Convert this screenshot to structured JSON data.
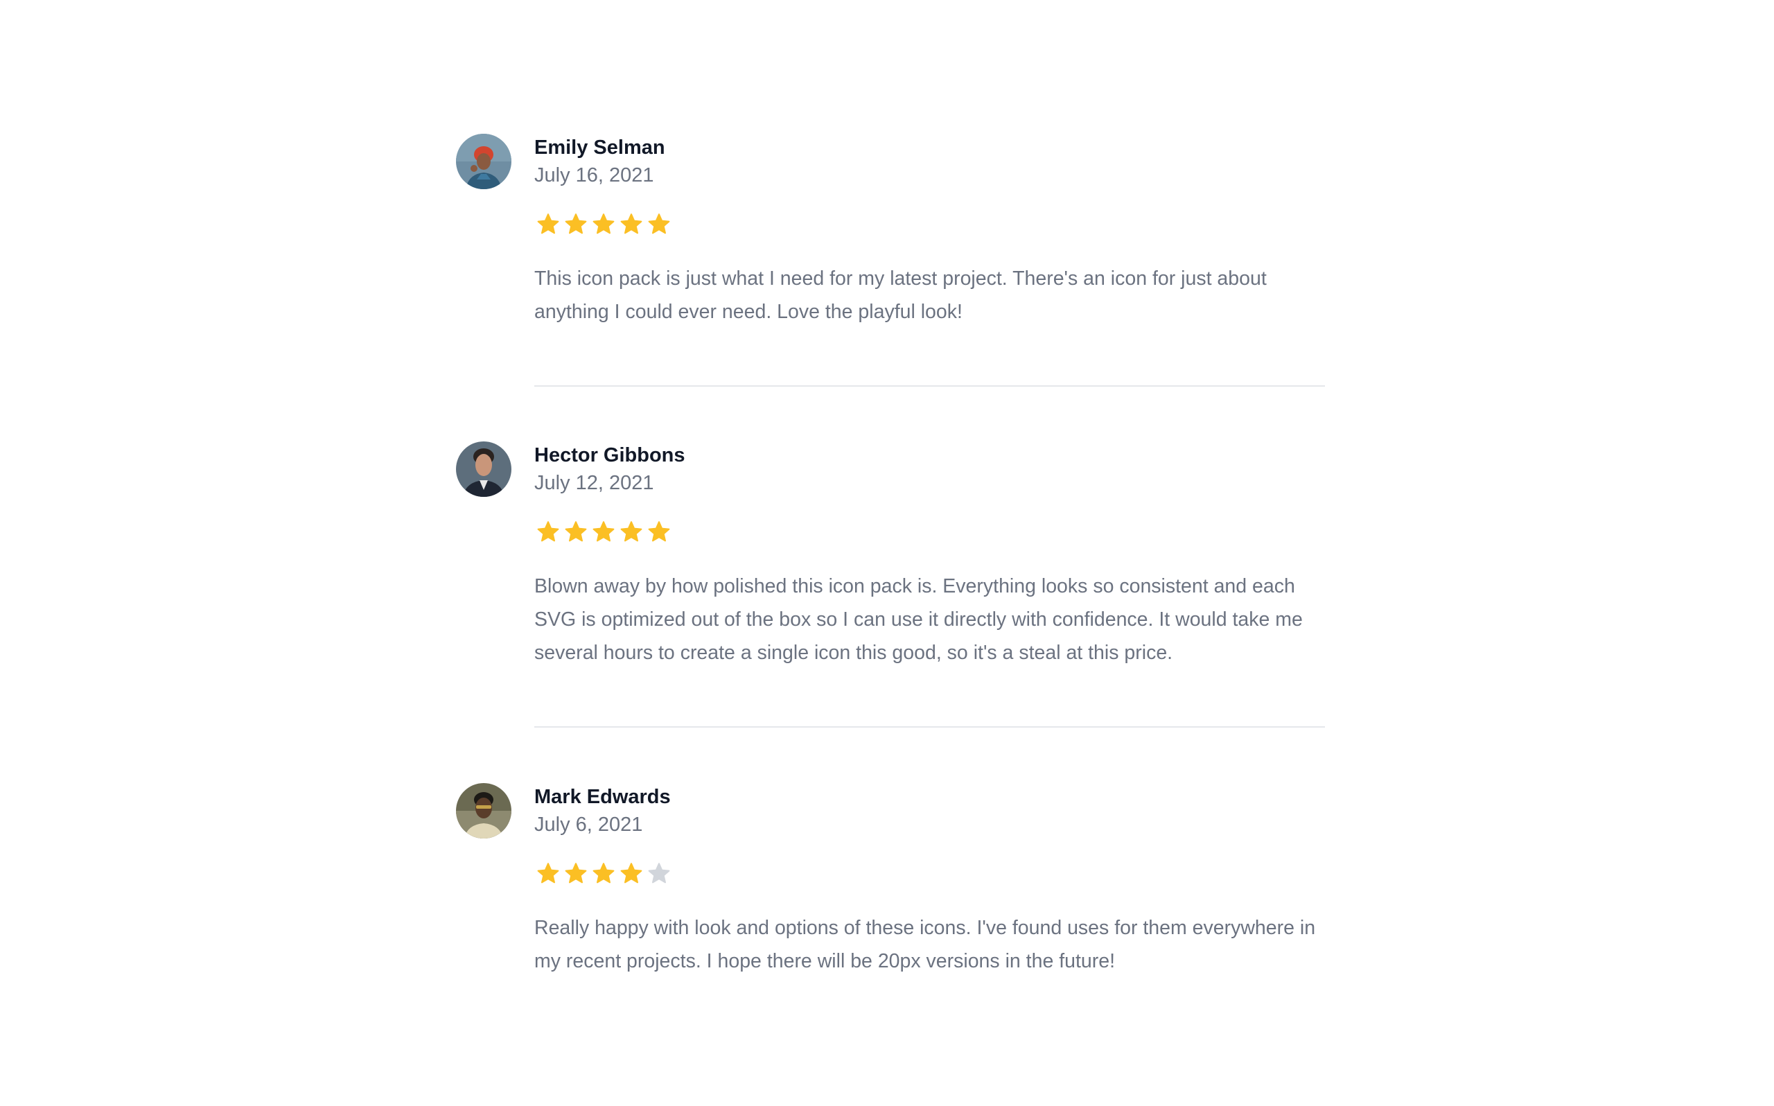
{
  "reviews": [
    {
      "name": "Emily Selman",
      "date": "July 16, 2021",
      "rating": 5,
      "max_rating": 5,
      "text": "This icon pack is just what I need for my latest project. There's an icon for just about anything I could ever need. Love the playful look!"
    },
    {
      "name": "Hector Gibbons",
      "date": "July 12, 2021",
      "rating": 5,
      "max_rating": 5,
      "text": "Blown away by how polished this icon pack is. Everything looks so consistent and each SVG is optimized out of the box so I can use it directly with confidence. It would take me several hours to create a single icon this good, so it's a steal at this price."
    },
    {
      "name": "Mark Edwards",
      "date": "July 6, 2021",
      "rating": 4,
      "max_rating": 5,
      "text": "Really happy with look and options of these icons. I've found uses for them everywhere in my recent projects. I hope there will be 20px versions in the future!"
    }
  ],
  "colors": {
    "star_filled": "#fbbf24",
    "star_empty": "#d1d5db",
    "name": "#111827",
    "muted": "#6b7280",
    "divider": "#e5e7eb"
  },
  "icons": {
    "star": "star-icon",
    "avatar": "avatar"
  }
}
